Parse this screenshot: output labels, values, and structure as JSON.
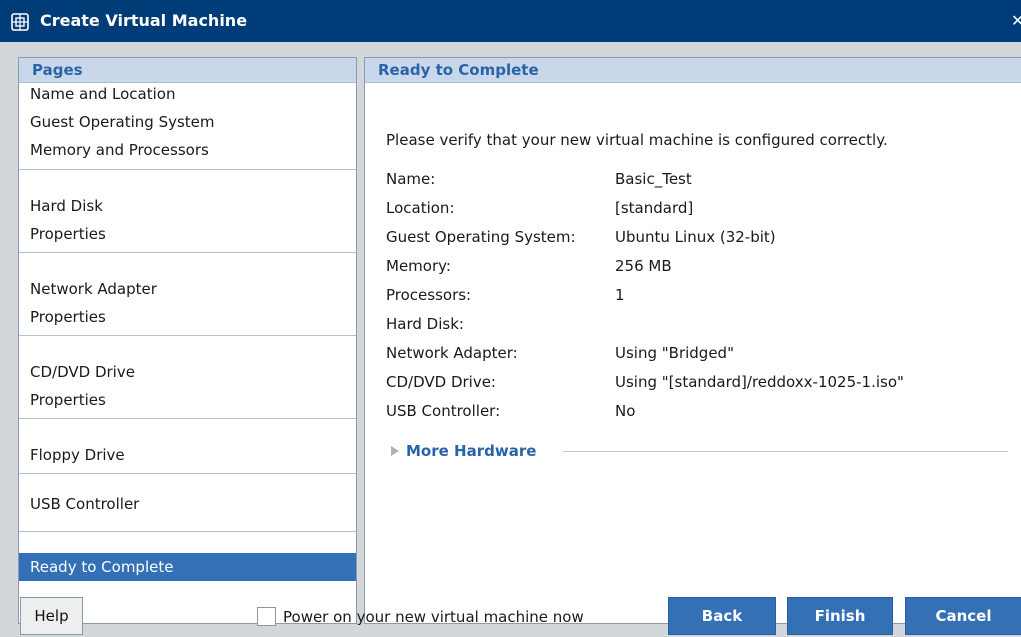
{
  "window": {
    "title": "Create Virtual Machine",
    "close_glyph": "✕",
    "icon": "virtual-machine-icon"
  },
  "pages": {
    "header": "Pages",
    "groups": [
      {
        "items": [
          "Name and Location",
          "Guest Operating System",
          "Memory and Processors"
        ]
      },
      {
        "items": [
          "Hard Disk",
          "Properties"
        ]
      },
      {
        "items": [
          "Network Adapter",
          "Properties"
        ]
      },
      {
        "items": [
          "CD/DVD Drive",
          "Properties"
        ]
      },
      {
        "items": [
          "Floppy Drive"
        ]
      },
      {
        "items": [
          "USB Controller"
        ]
      },
      {
        "items": [
          "Ready to Complete"
        ],
        "selected": true
      }
    ]
  },
  "ready": {
    "header": "Ready to Complete",
    "intro": "Please verify that your new virtual machine is configured correctly.",
    "rows": [
      {
        "label": "Name:",
        "value": "Basic_Test"
      },
      {
        "label": "Location:",
        "value": "[standard]"
      },
      {
        "label": "Guest Operating System:",
        "value": "Ubuntu Linux (32-bit)"
      },
      {
        "label": "Memory:",
        "value": "256 MB"
      },
      {
        "label": "Processors:",
        "value": "1"
      },
      {
        "label": "Hard Disk:",
        "value": ""
      },
      {
        "label": "Network Adapter:",
        "value": "Using \"Bridged\""
      },
      {
        "label": "CD/DVD Drive:",
        "value": "Using \"[standard]/reddoxx-1025-1.iso\""
      },
      {
        "label": "USB Controller:",
        "value": "No"
      }
    ],
    "more_hardware": "More Hardware"
  },
  "footer": {
    "help": "Help",
    "power_on_label": "Power on your new virtual machine now",
    "power_on_checked": false,
    "back": "Back",
    "finish": "Finish",
    "cancel": "Cancel"
  },
  "colors": {
    "titlebar": "#003c78",
    "panel_header": "#c8d8ea",
    "accent": "#3370b5",
    "background": "#d3d7db"
  }
}
